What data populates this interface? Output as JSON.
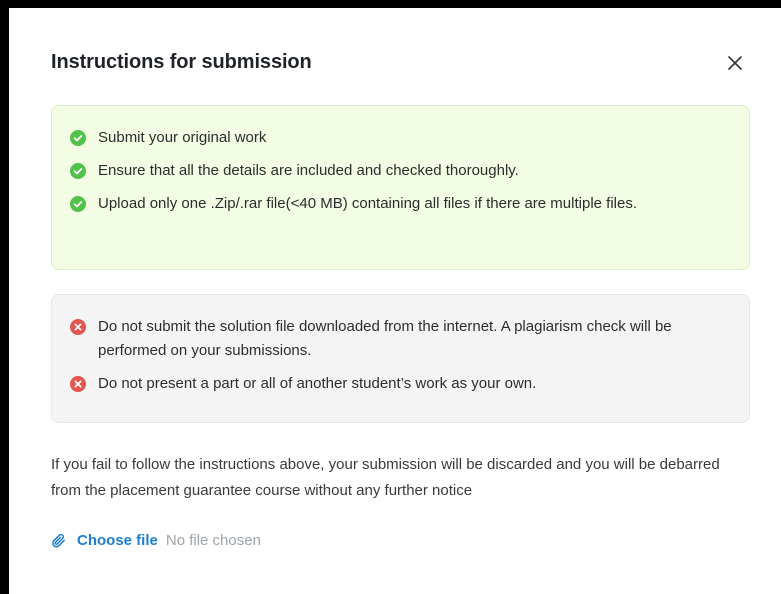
{
  "modal": {
    "title": "Instructions for submission",
    "close_icon": "close-icon"
  },
  "dos": {
    "icon": "check-circle-icon",
    "color": "#52c14b",
    "background": "#f2fde4",
    "items": [
      "Submit your original work",
      "Ensure that all the details are included and checked thoroughly.",
      "Upload only one .Zip/.rar file(<40 MB) containing all files if there are multiple files."
    ]
  },
  "donts": {
    "icon": "x-circle-icon",
    "color": "#e2564d",
    "background": "#f4f4f4",
    "items": [
      "Do not submit the solution file downloaded from the internet. A plagiarism check will be performed on your submissions.",
      "Do not present a part or all of another student’s work as your own."
    ]
  },
  "warning": "If you fail to follow the instructions above, your submission will be discarded and you will be debarred from the placement guarantee course without any further notice",
  "file": {
    "icon": "paperclip-icon",
    "choose_label": "Choose file",
    "status": "No file chosen",
    "accent": "#1e7fce"
  }
}
